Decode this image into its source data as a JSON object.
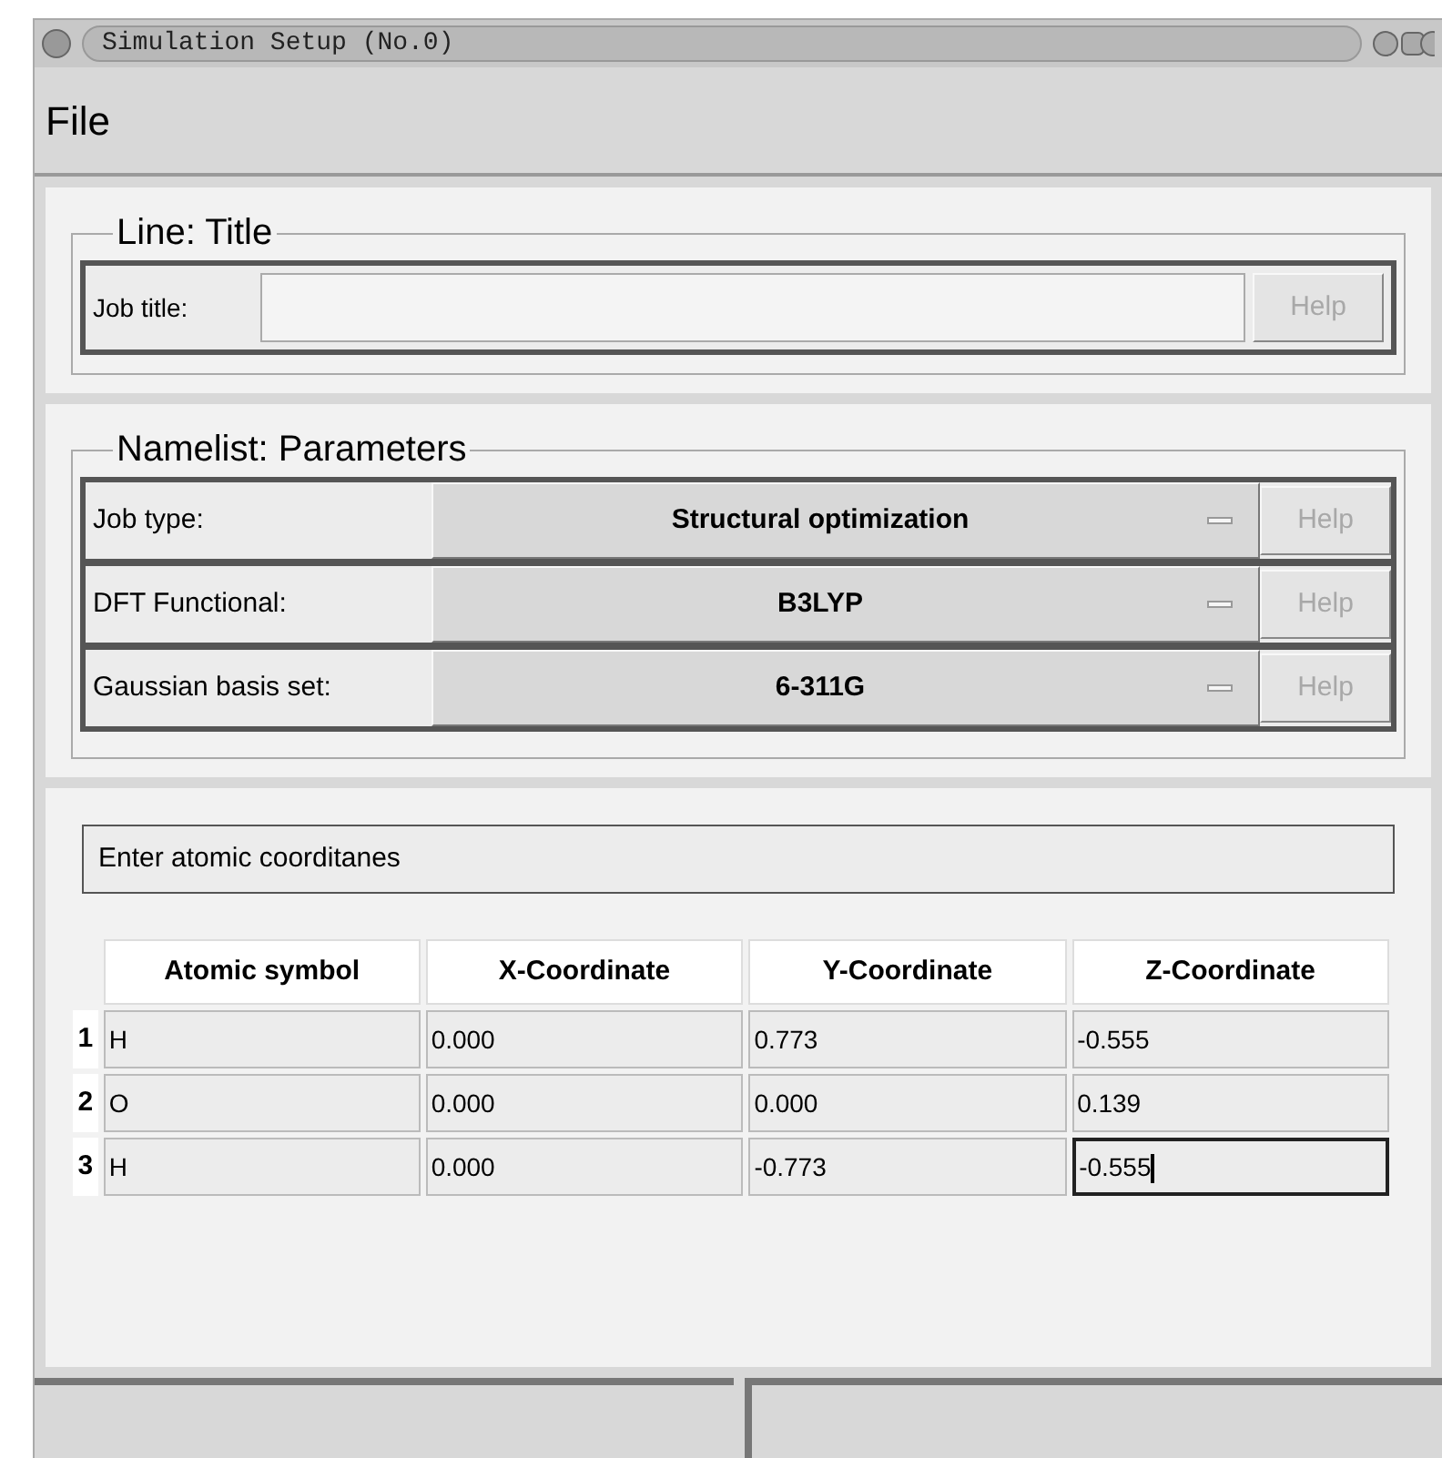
{
  "window": {
    "title": "Simulation Setup (No.0)"
  },
  "menu": [
    "File"
  ],
  "title_section": {
    "legend": "Line: Title",
    "label": "Job title:",
    "help": {
      "label": "Help",
      "disabled": true
    }
  },
  "parameters_section": {
    "legend": "Namelist: Parameters",
    "rows": [
      {
        "label": "Job type:",
        "value": "Structural optimization",
        "help": {
          "label": "Help",
          "disabled": true
        }
      },
      {
        "label": "DFT Functional:",
        "value": "B3LYP",
        "help": {
          "label": "Help",
          "disabled": true
        }
      },
      {
        "label": "Gaussian basis set:",
        "value": "6-311G",
        "help": {
          "label": "Help",
          "disabled": true
        }
      }
    ]
  },
  "coordinates_section": {
    "heading": "Enter atomic coorditanes",
    "table": {
      "columns": [
        "Atomic symbol",
        "X-Coordinate",
        "Y-Coordinate",
        "Z-Coordinate"
      ],
      "rows": [
        {
          "number": "1",
          "cells": [
            {
              "value": "H",
              "focused": false
            },
            {
              "value": "0.000",
              "focused": false
            },
            {
              "value": "0.773",
              "focused": false
            },
            {
              "value": "-0.555",
              "focused": false
            }
          ]
        },
        {
          "number": "2",
          "cells": [
            {
              "value": "O",
              "focused": false
            },
            {
              "value": "0.000",
              "focused": false
            },
            {
              "value": "0.000",
              "focused": false
            },
            {
              "value": "0.139",
              "focused": false
            }
          ]
        },
        {
          "number": "3",
          "cells": [
            {
              "value": "H",
              "focused": false
            },
            {
              "value": "0.000",
              "focused": false
            },
            {
              "value": "-0.773",
              "focused": false
            },
            {
              "value": "-0.555",
              "focused": true
            }
          ]
        }
      ]
    }
  }
}
